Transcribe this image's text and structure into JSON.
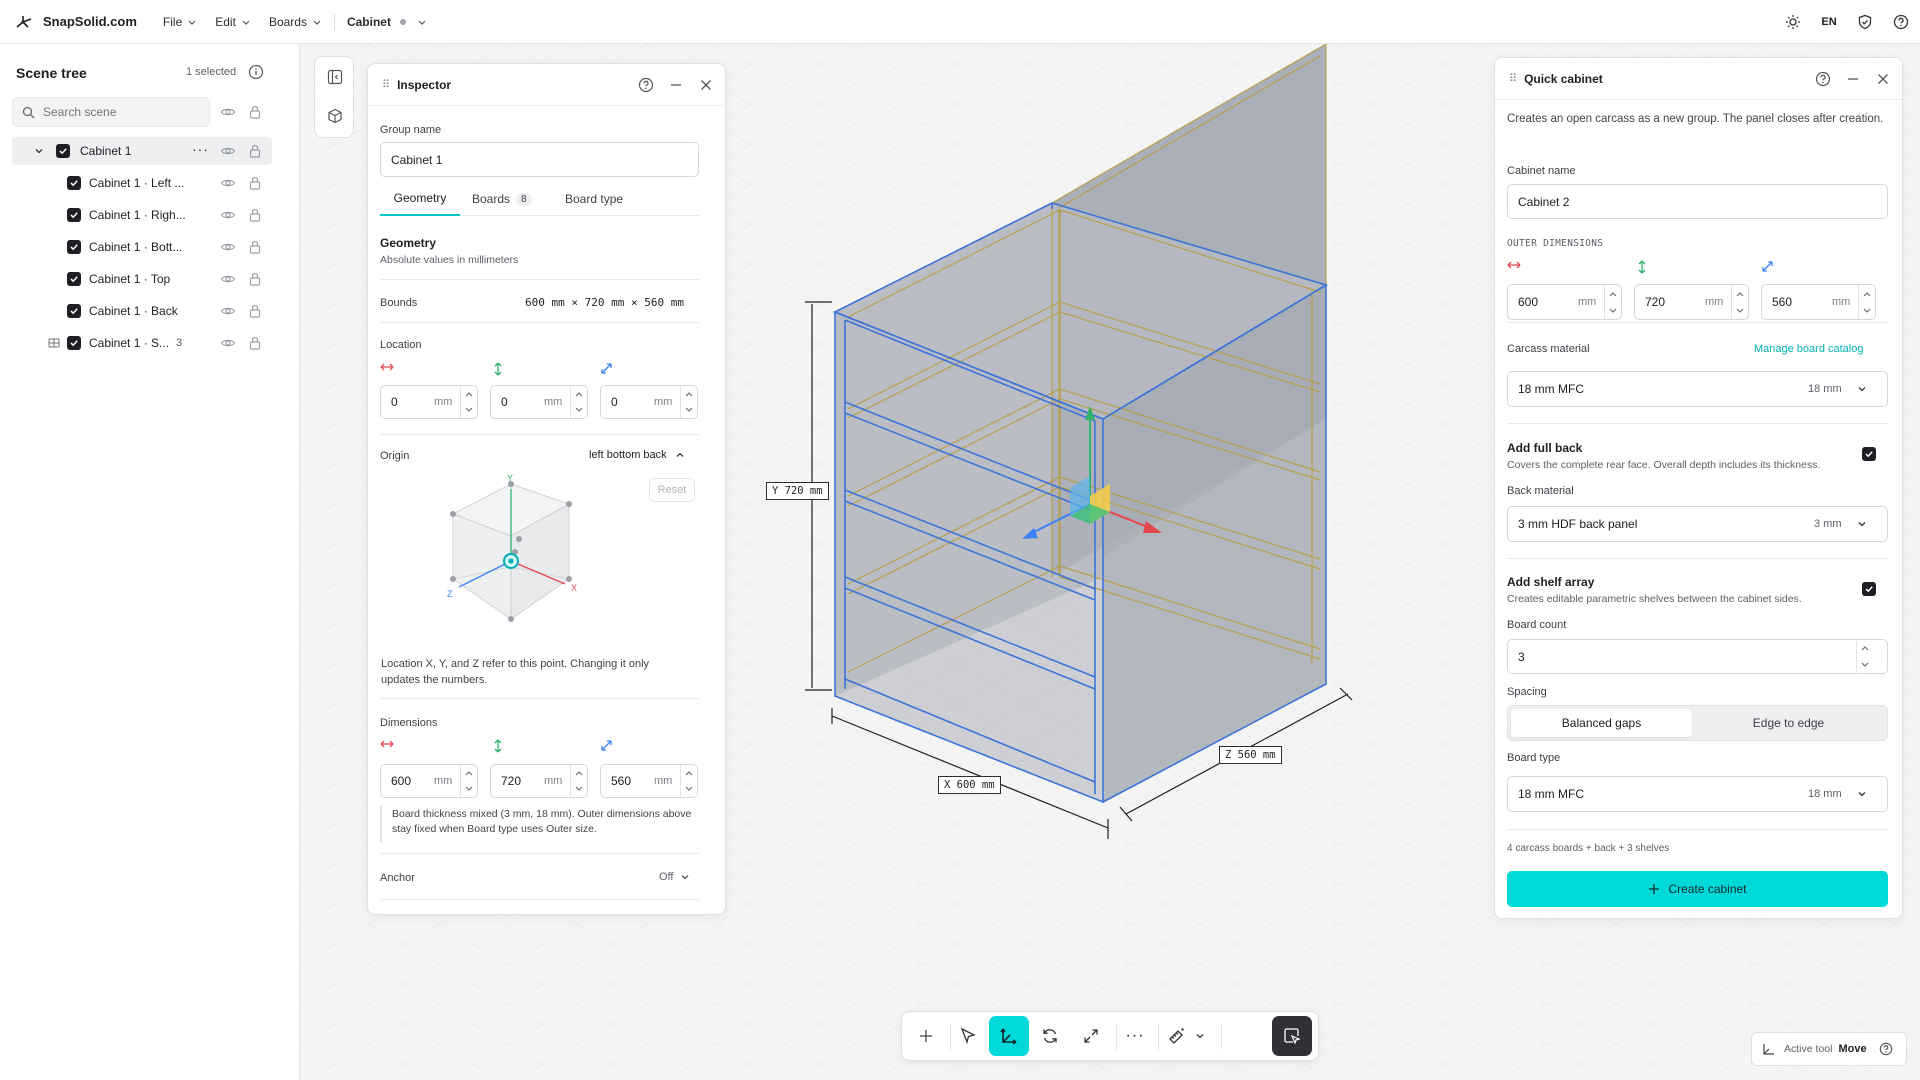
{
  "app": {
    "brand": "SnapSolid.com"
  },
  "menu": {
    "file": "File",
    "edit": "Edit",
    "boards": "Boards",
    "doc": "Cabinet"
  },
  "topright": {
    "lang": "EN"
  },
  "scene": {
    "title": "Scene tree",
    "selected": "1 selected",
    "search_placeholder": "Search scene",
    "root": "Cabinet 1",
    "items": [
      "Cabinet 1 · Left ...",
      "Cabinet 1 · Righ...",
      "Cabinet 1 · Bott...",
      "Cabinet 1 · Top",
      "Cabinet 1 · Back",
      "Cabinet 1 · S..."
    ],
    "shelf_count": "3"
  },
  "inspector": {
    "title": "Inspector",
    "group_label": "Group name",
    "group_value": "Cabinet 1",
    "tabs": {
      "geometry": "Geometry",
      "boards": "Boards",
      "boards_count": "8",
      "board_type": "Board type"
    },
    "section_title": "Geometry",
    "section_sub": "Absolute values in millimeters",
    "bounds_label": "Bounds",
    "bounds_value": "600 mm × 720 mm × 560 mm",
    "location_label": "Location",
    "loc": {
      "x": "0",
      "y": "0",
      "z": "0",
      "unit": "mm"
    },
    "origin_label": "Origin",
    "origin_value": "left bottom back",
    "reset": "Reset",
    "axis": {
      "x": "X",
      "y": "Y",
      "z": "Z"
    },
    "origin_note": "Location X, Y, and Z refer to this point. Changing it only updates the numbers.",
    "dims_label": "Dimensions",
    "dims": {
      "x": "600",
      "y": "720",
      "z": "560",
      "unit": "mm"
    },
    "dims_note": "Board thickness mixed (3 mm, 18 mm). Outer dimensions above stay fixed when Board type uses Outer size.",
    "anchor_label": "Anchor",
    "anchor_value": "Off"
  },
  "viewport": {
    "tag_y": "Y 720 mm",
    "tag_x": "X 600 mm",
    "tag_z": "Z 560 mm",
    "active_tool_label": "Active tool",
    "active_tool_value": "Move"
  },
  "quick": {
    "title": "Quick cabinet",
    "desc": "Creates an open carcass as a new group. The panel closes after creation.",
    "name_label": "Cabinet name",
    "name_value": "Cabinet 2",
    "outer_label": "OUTER DIMENSIONS",
    "outer": {
      "x": "600",
      "y": "720",
      "z": "560",
      "unit": "mm"
    },
    "carcass_label": "Carcass material",
    "manage_link": "Manage board catalog",
    "carcass_value": "18 mm MFC",
    "carcass_thk": "18 mm",
    "fullback_title": "Add full back",
    "fullback_desc": "Covers the complete rear face. Overall depth includes its thickness.",
    "back_label": "Back material",
    "back_value": "3 mm HDF back panel",
    "back_thk": "3 mm",
    "shelf_title": "Add shelf array",
    "shelf_desc": "Creates editable parametric shelves between the cabinet sides.",
    "count_label": "Board count",
    "count_value": "3",
    "spacing_label": "Spacing",
    "spacing_a": "Balanced gaps",
    "spacing_b": "Edge to edge",
    "boardtype_label": "Board type",
    "boardtype_value": "18 mm MFC",
    "boardtype_thk": "18 mm",
    "summary": "4 carcass boards + back + 3 shelves",
    "create": "Create cabinet"
  },
  "colors": {
    "accent": "#00d9d9",
    "red": "#e5484d",
    "green": "#2fb36b",
    "blue": "#3b82f6"
  }
}
